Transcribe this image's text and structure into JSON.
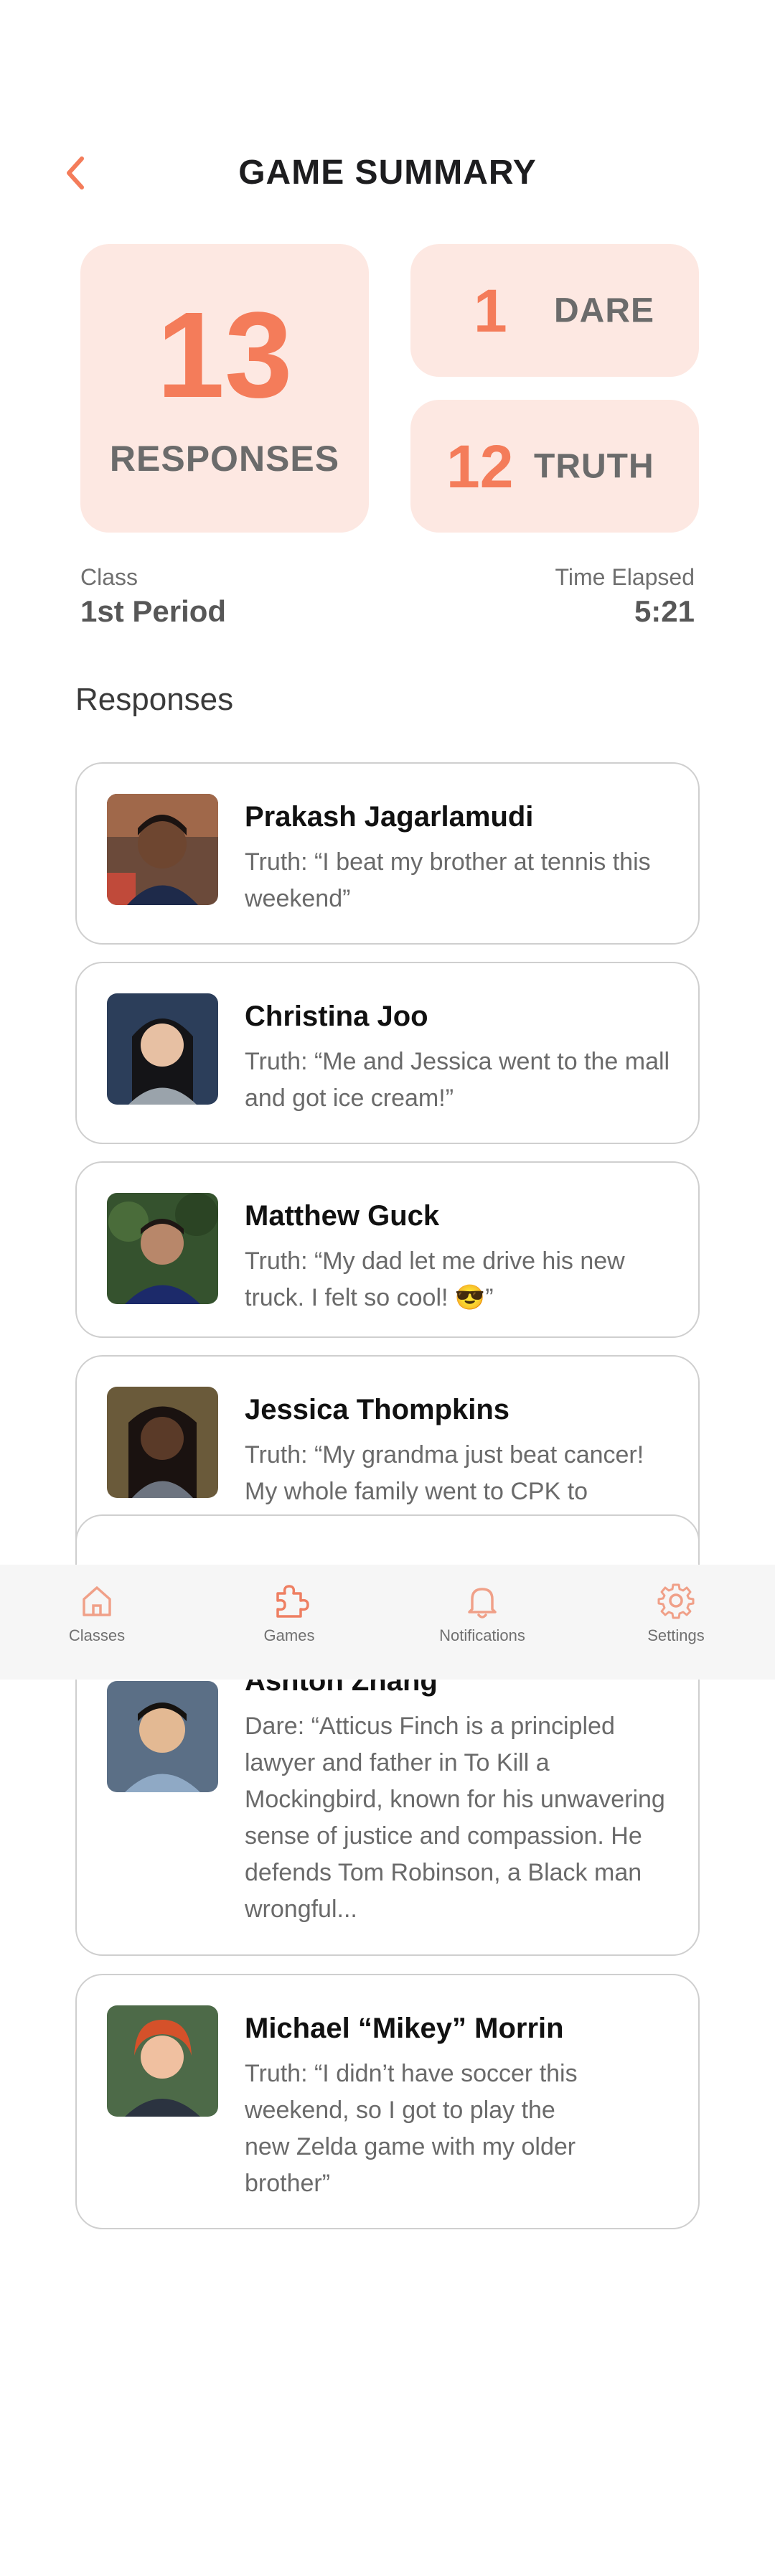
{
  "header": {
    "title": "GAME SUMMARY"
  },
  "stats": {
    "responses_count": "13",
    "responses_label": "RESPONSES",
    "dare_count": "1",
    "dare_label": "DARE",
    "truth_count": "12",
    "truth_label": "TRUTH"
  },
  "meta": {
    "class_label": "Class",
    "class_value": "1st Period",
    "time_label": "Time Elapsed",
    "time_value": "5:21"
  },
  "responses_title": "Responses",
  "responses": [
    {
      "name": "Prakash Jagarlamudi",
      "text": "Truth: “I beat my brother at tennis this weekend”"
    },
    {
      "name": "Christina Joo",
      "text": "Truth: “Me and Jessica went to the mall and got ice cream!”"
    },
    {
      "name": "Matthew Guck",
      "text": "Truth: “My dad let me drive his new truck. I felt so cool! 😎”"
    },
    {
      "name": "Jessica Thompkins",
      "text": "Truth: “My grandma just beat cancer! My whole family went to CPK to celebrate. My uncle gave me $40, so I went to the mall with tina!"
    },
    {
      "name": "Ashton Zhang",
      "text": "Dare: “Atticus Finch is a principled lawyer and father in To Kill a Mockingbird, known for his unwavering sense of justice and compassion. He defends Tom Robinson, a Black man wrongful..."
    },
    {
      "name": "Michael “Mikey” Morrin",
      "text": "Truth: “I didn’t have soccer this weekend, so I got to play the new Zelda game with my older brother”"
    }
  ],
  "tabbar": {
    "tabs": [
      {
        "label": "Classes",
        "icon": "home-icon"
      },
      {
        "label": "Games",
        "icon": "puzzle-icon"
      },
      {
        "label": "Notifications",
        "icon": "bell-icon"
      },
      {
        "label": "Settings",
        "icon": "gear-icon"
      }
    ]
  },
  "colors": {
    "accent": "#f47c5a",
    "tile": "#fde8e2"
  }
}
